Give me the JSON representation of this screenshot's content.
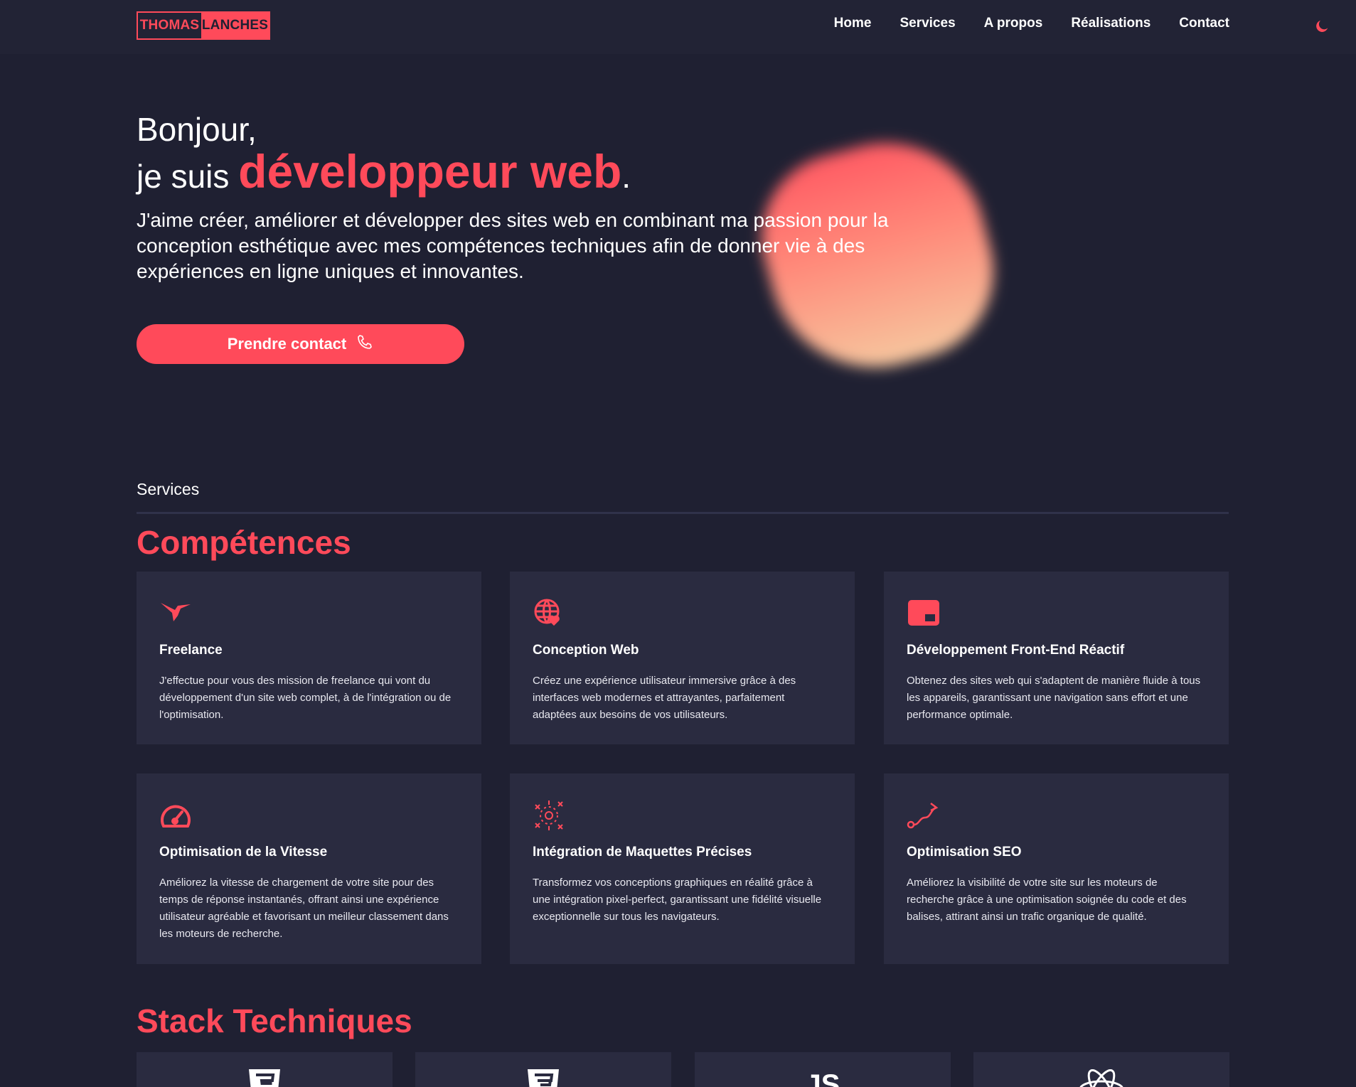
{
  "nav": {
    "logo_first": "THOMAS",
    "logo_last": "LANCHES",
    "items": [
      {
        "label": "Home"
      },
      {
        "label": "Services"
      },
      {
        "label": "A propos"
      },
      {
        "label": "Réalisations"
      },
      {
        "label": "Contact"
      }
    ],
    "theme_toggle_icon": "moon-icon"
  },
  "hero": {
    "greeting": "Bonjour,",
    "intro_prefix": "je suis ",
    "highlight": "développeur web",
    "suffix": ".",
    "description": "J'aime créer, améliorer et développer des sites web en combinant ma passion pour la conception esthétique avec mes compétences techniques afin de donner vie à des expériences en ligne uniques et innovantes.",
    "cta_label": "Prendre contact",
    "cta_icon": "phone-icon"
  },
  "services": {
    "section_label": "Services",
    "heading": "Compétences",
    "cards": [
      {
        "icon": "hummingbird-icon",
        "title": "Freelance",
        "description": "J'effectue pour vous des mission de freelance qui vont du développement d'un site web complet, à de l'intégration ou de l'optimisation."
      },
      {
        "icon": "globe-heart-icon",
        "title": "Conception Web",
        "description": "Créez une expérience utilisateur immersive grâce à des interfaces web modernes et attrayantes, parfaitement adaptées aux besoins de vos utilisateurs."
      },
      {
        "icon": "window-icon",
        "title": "Développement Front-End Réactif",
        "description": "Obtenez des sites web qui s'adaptent de manière fluide à tous les appareils, garantissant une navigation sans effort et une performance optimale."
      },
      {
        "icon": "speedometer-icon",
        "title": "Optimisation de la Vitesse",
        "description": "Améliorez la vitesse de chargement de votre site pour des temps de réponse instantanés, offrant ainsi une expérience utilisateur agréable et favorisant un meilleur classement dans les moteurs de recherche."
      },
      {
        "icon": "target-arrows-icon",
        "title": "Intégration de Maquettes Précises",
        "description": "Transformez vos conceptions graphiques en réalité grâce à une intégration pixel-perfect, garantissant une fidélité visuelle exceptionnelle sur tous les navigateurs."
      },
      {
        "icon": "route-icon",
        "title": "Optimisation SEO",
        "description": "Améliorez la visibilité de votre site sur les moteurs de recherche grâce à une optimisation soignée du code et des balises, attirant ainsi un trafic organique de qualité."
      }
    ]
  },
  "stack": {
    "heading": "Stack Techniques",
    "items": [
      {
        "icon": "html5-icon"
      },
      {
        "icon": "css3-icon"
      },
      {
        "icon": "js-icon",
        "label": "JS"
      },
      {
        "icon": "react-icon"
      }
    ]
  },
  "colors": {
    "accent": "#ff4a5a",
    "background": "#1f2032",
    "card": "#2a2b40"
  }
}
